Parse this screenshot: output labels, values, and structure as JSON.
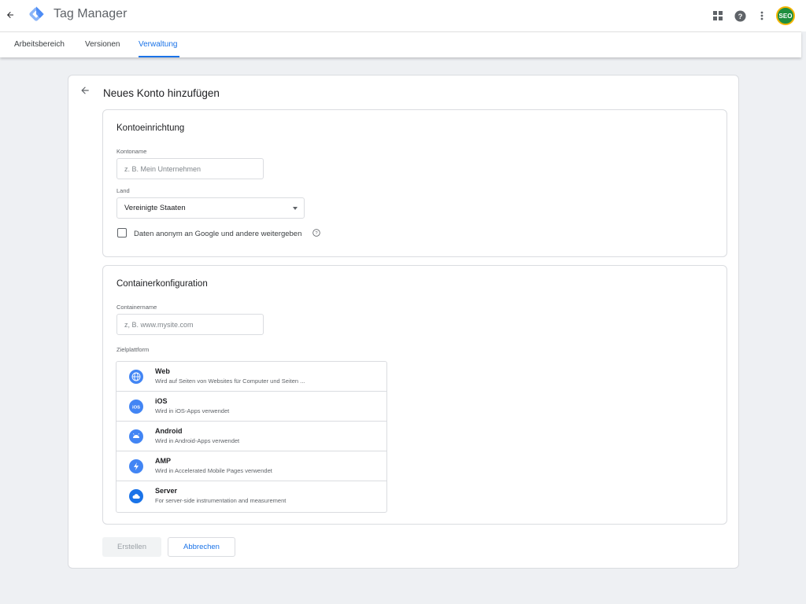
{
  "app": {
    "title": "Tag Manager",
    "avatar_initials": "SEO"
  },
  "colors": {
    "accent": "#1a73e8",
    "platform_icon": "#4285f4",
    "avatar_bg": "#1e8e3e"
  },
  "tabs": [
    {
      "label": "Arbeitsbereich",
      "active": false
    },
    {
      "label": "Versionen",
      "active": false
    },
    {
      "label": "Verwaltung",
      "active": true
    }
  ],
  "page": {
    "title": "Neues Konto hinzufügen"
  },
  "account_setup": {
    "title": "Kontoeinrichtung",
    "account_name_label": "Kontoname",
    "account_name_placeholder": "z. B. Mein Unternehmen",
    "account_name_value": "",
    "country_label": "Land",
    "country_value": "Vereinigte Staaten",
    "share_data_label": "Daten anonym an Google und andere weitergeben",
    "share_data_checked": false
  },
  "container_setup": {
    "title": "Containerkonfiguration",
    "container_name_label": "Containername",
    "container_name_placeholder": "z, B. www.mysite.com",
    "container_name_value": "",
    "target_platform_label": "Zielplattform",
    "platforms": [
      {
        "name": "Web",
        "description": "Wird auf Seiten von Websites für Computer und Seiten ...",
        "icon": "globe-icon"
      },
      {
        "name": "iOS",
        "description": "Wird in iOS-Apps verwendet",
        "icon": "ios-icon"
      },
      {
        "name": "Android",
        "description": "Wird in Android-Apps verwendet",
        "icon": "android-icon"
      },
      {
        "name": "AMP",
        "description": "Wird in Accelerated Mobile Pages verwendet",
        "icon": "bolt-icon"
      },
      {
        "name": "Server",
        "description": "For server-side instrumentation and measurement",
        "icon": "cloud-icon"
      }
    ]
  },
  "actions": {
    "create_label": "Erstellen",
    "cancel_label": "Abbrechen"
  }
}
